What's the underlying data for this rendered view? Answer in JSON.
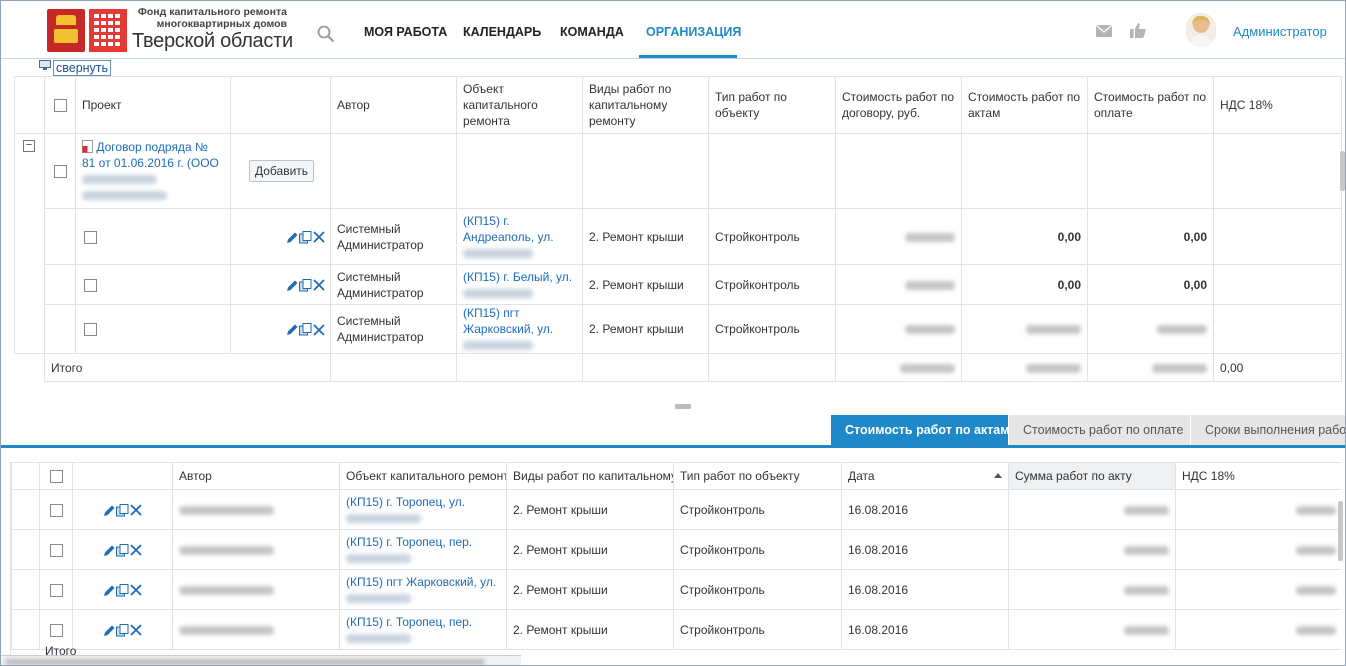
{
  "header": {
    "logo_line1": "Фонд капитального ремонта",
    "logo_line2": "многоквартирных домов",
    "logo_line3": "Тверской области",
    "nav": [
      "МОЯ РАБОТА",
      "КАЛЕНДАРЬ",
      "КОМАНДА",
      "ОРГАНИЗАЦИЯ"
    ],
    "active_nav": "ОРГАНИЗАЦИЯ",
    "user_name": "Администратор"
  },
  "collapse_label": "свернуть",
  "upper_table": {
    "columns": [
      "",
      "Проект",
      "",
      "Автор",
      "Объект капитального ремонта",
      "Виды работ по капитальному ремонту",
      "Тип работ по объекту",
      "Стоимость работ по договору, руб.",
      "Стоимость работ по актам",
      "Стоимость работ по оплате",
      "НДС 18%"
    ],
    "group": {
      "title": "Договор подряда № 81 от 01.06.2016 г. (ООО",
      "add_button": "Добавить"
    },
    "rows": [
      {
        "author": "Системный Администратор",
        "object": "(КП15) г. Андреаполь, ул.",
        "work_kind": "2. Ремонт крыши",
        "work_type": "Стройконтроль",
        "acts": "0,00",
        "payment": "0,00"
      },
      {
        "author": "Системный Администратор",
        "object": "(КП15) г. Белый, ул.",
        "work_kind": "2. Ремонт крыши",
        "work_type": "Стройконтроль",
        "acts": "0,00",
        "payment": "0,00"
      },
      {
        "author": "Системный Администратор",
        "object": "(КП15) пгт Жарковский, ул.",
        "work_kind": "2. Ремонт крыши",
        "work_type": "Стройконтроль",
        "acts": "",
        "payment": ""
      }
    ],
    "total_label": "Итого",
    "total_vat": "0,00"
  },
  "tabs": [
    "Стоимость работ по актам",
    "Стоимость работ по оплате",
    "Сроки выполнения работ"
  ],
  "lower_table": {
    "columns": [
      "",
      "",
      "Автор",
      "Объект капитального ремонта",
      "Виды работ по капитальному",
      "Тип работ по объекту",
      "Дата",
      "Сумма работ по акту",
      "НДС 18%"
    ],
    "rows": [
      {
        "object": "(КП15) г. Торопец, ул.",
        "work_kind": "2. Ремонт крыши",
        "work_type": "Стройконтроль",
        "date": "16.08.2016"
      },
      {
        "object": "(КП15) г. Торопец, пер.",
        "work_kind": "2. Ремонт крыши",
        "work_type": "Стройконтроль",
        "date": "16.08.2016"
      },
      {
        "object": "(КП15) пгт Жарковский, ул.",
        "work_kind": "2. Ремонт крыши",
        "work_type": "Стройконтроль",
        "date": "16.08.2016"
      },
      {
        "object": "(КП15) г. Торопец, пер.",
        "work_kind": "2. Ремонт крыши",
        "work_type": "Стройконтроль",
        "date": "16.08.2016"
      }
    ],
    "total_label": "Итого"
  },
  "colors": {
    "accent": "#1e88c8",
    "link": "#1e6bb8",
    "brand_red": "#c62828"
  }
}
